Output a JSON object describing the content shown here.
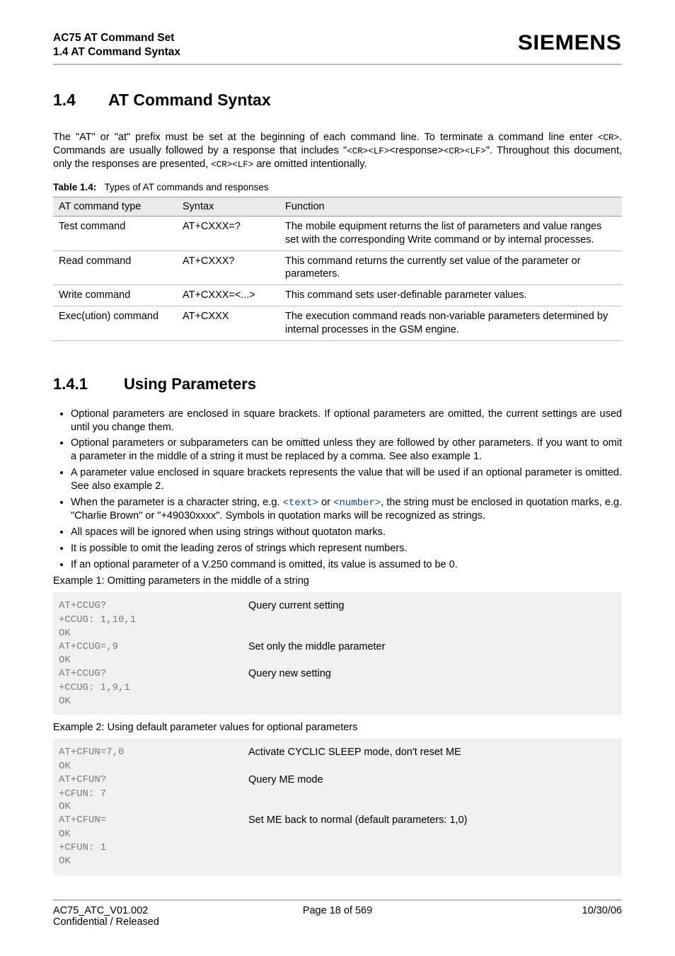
{
  "header": {
    "title": "AC75 AT Command Set",
    "subtitle": "1.4 AT Command Syntax",
    "brand": "SIEMENS"
  },
  "sec14": {
    "num": "1.4",
    "title": "AT Command Syntax",
    "intro_pre": "The \"AT\" or \"at\" prefix must be set at the beginning of each command line. To terminate a command line enter ",
    "cr": "<CR>",
    "intro_mid1": ". Commands are usually followed by a response that includes \"",
    "resp1": "<CR><LF>",
    "intro_mid2": "<response>",
    "resp2": "<CR><LF>",
    "intro_mid3": "\". Throughout this document, only the responses are presented, ",
    "resp3": "<CR><LF>",
    "intro_end": " are omitted intentionally.",
    "table_caption_bold": "Table 1.4:",
    "table_caption_rest": "Types of AT commands and responses",
    "thead": [
      "AT command type",
      "Syntax",
      "Function"
    ],
    "rows": [
      {
        "type": "Test command",
        "syntax": "AT+CXXX=?",
        "func": "The mobile equipment returns the list of parameters and value ranges set with the corresponding Write command or by internal processes."
      },
      {
        "type": "Read command",
        "syntax": "AT+CXXX?",
        "func": "This command returns the currently set value of the parameter or parameters."
      },
      {
        "type": "Write command",
        "syntax": "AT+CXXX=<...>",
        "func": "This command sets user-definable parameter values."
      },
      {
        "type": "Exec(ution) command",
        "syntax": "AT+CXXX",
        "func": "The execution command reads non-variable parameters determined by internal processes in the GSM engine."
      }
    ]
  },
  "sec141": {
    "num": "1.4.1",
    "title": "Using Parameters",
    "bullets": {
      "b1": "Optional parameters are enclosed in square brackets. If optional parameters are omitted, the current settings are used until you change them.",
      "b2": "Optional parameters or subparameters can be omitted unless they are followed by other parameters. If you want to omit a parameter in the middle of a string it must be replaced by a comma. See also example 1.",
      "b3": "A parameter value enclosed in square brackets represents the value that will be used if an optional parameter is omitted. See also example 2.",
      "b4_pre": "When the parameter is a character string, e.g. ",
      "b4_text": "<text>",
      "b4_mid": " or ",
      "b4_number": "<number>",
      "b4_post": ", the string must be enclosed in quotation marks, e.g. \"Charlie Brown\" or \"+49030xxxx\". Symbols in quotation marks will be recognized as strings.",
      "b5": "All spaces will be ignored when using strings without quotaton marks.",
      "b6": "It is possible to omit the leading zeros of strings which represent numbers.",
      "b7": "If an optional parameter of a V.250 command is omitted, its value is assumed to be 0."
    },
    "ex1_title": "Example 1: Omitting parameters in the middle of a string",
    "ex1": [
      {
        "l": "AT+CCUG?",
        "r": "Query current setting"
      },
      {
        "l": "+CCUG: 1,10,1",
        "r": ""
      },
      {
        "l": "OK",
        "r": ""
      },
      {
        "l": "AT+CCUG=,9",
        "r": "Set only the middle parameter"
      },
      {
        "l": "OK",
        "r": ""
      },
      {
        "l": "AT+CCUG?",
        "r": "Query new setting"
      },
      {
        "l": "+CCUG: 1,9,1",
        "r": ""
      },
      {
        "l": "OK",
        "r": ""
      }
    ],
    "ex2_title": "Example 2: Using default parameter values for optional parameters",
    "ex2": [
      {
        "l": "AT+CFUN=7,0",
        "r": "Activate CYCLIC SLEEP mode, don't reset ME"
      },
      {
        "l": "OK",
        "r": ""
      },
      {
        "l": "AT+CFUN?",
        "r": "Query ME mode"
      },
      {
        "l": "+CFUN: 7",
        "r": ""
      },
      {
        "l": "OK",
        "r": ""
      },
      {
        "l": "AT+CFUN=",
        "r": "Set ME back to normal (default parameters: 1,0)"
      },
      {
        "l": "OK",
        "r": ""
      },
      {
        "l": "+CFUN: 1",
        "r": ""
      },
      {
        "l": "OK",
        "r": ""
      }
    ]
  },
  "footer": {
    "left1": "AC75_ATC_V01.002",
    "left2": "Confidential / Released",
    "center": "Page 18 of 569",
    "right": "10/30/06"
  }
}
